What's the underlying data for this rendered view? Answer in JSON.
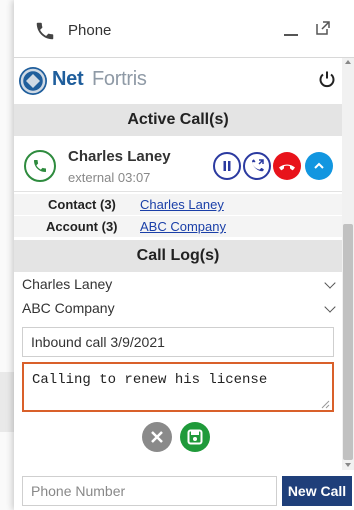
{
  "window": {
    "title": "Phone",
    "phone_icon": "phone-icon",
    "minimize_icon": "minimize-icon",
    "popout_icon": "popout-icon"
  },
  "brand": {
    "logo_net": "Net",
    "logo_fortris": "Fortris",
    "power_icon": "power-icon"
  },
  "active_calls": {
    "header": "Active Call(s)",
    "call": {
      "caller_name": "Charles Laney",
      "call_type": "external",
      "duration": "03:07",
      "controls": [
        "hold-icon",
        "transfer-icon",
        "hangup-icon",
        "expand-icon"
      ]
    },
    "related": [
      {
        "key": "Contact (3)",
        "value": "Charles Laney"
      },
      {
        "key": "Account (3)",
        "value": "ABC Company"
      }
    ]
  },
  "call_log": {
    "header": "Call Log(s)",
    "contact_select": "Charles Laney",
    "account_select": "ABC Company",
    "subject": "Inbound call 3/9/2021",
    "notes": "Calling to renew his license"
  },
  "footer": {
    "phone_placeholder": "Phone Number",
    "new_call_label": "New Call"
  },
  "colors": {
    "accent_green": "#1f9a3a",
    "hangup_red": "#e8131b",
    "expand_blue": "#1296e0",
    "highlight_orange": "#d9602a",
    "button_navy": "#1f3f7a"
  }
}
